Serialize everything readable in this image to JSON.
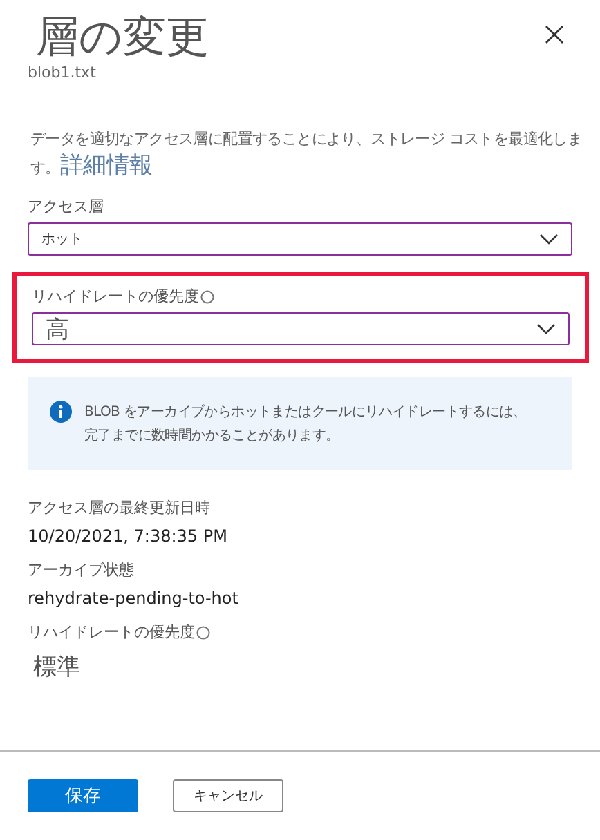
{
  "title": "層の変更",
  "subtitle": "blob1.txt",
  "description": {
    "text": "データを適切なアクセス層に配置することにより、ストレージ コストを最適化します。",
    "link": "詳細情報"
  },
  "fields": [
    {
      "label": "アクセス層",
      "value": "ホット",
      "info_icon": false,
      "highlighted": false,
      "large": false
    },
    {
      "label": "リハイドレートの優先度",
      "value": "高",
      "info_icon": true,
      "highlighted": true,
      "large": true
    }
  ],
  "notice": {
    "lines": [
      "BLOB をアーカイブからホットまたはクールにリハイドレートするには、",
      "完了までに数時間かかることがあります。"
    ]
  },
  "properties": [
    {
      "label": "アクセス層の最終更新日時",
      "value": "10/20/2021, 7:38:35 PM",
      "info_icon": false,
      "large": false
    },
    {
      "label": "アーカイブ状態",
      "value": "rehydrate-pending-to-hot",
      "info_icon": false,
      "large": false
    },
    {
      "label": "リハイドレートの優先度",
      "value": "標準",
      "info_icon": true,
      "large": true
    }
  ],
  "buttons": [
    {
      "label": "保存",
      "kind": "primary"
    },
    {
      "label": "キャンセル",
      "kind": "secondary"
    }
  ]
}
